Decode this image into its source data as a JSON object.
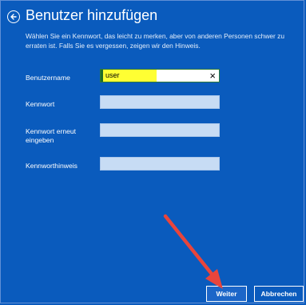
{
  "header": {
    "title": "Benutzer hinzufügen",
    "description": "Wählen Sie ein Kennwort, das leicht zu merken, aber von anderen Personen schwer zu erraten ist. Falls Sie es vergessen, zeigen wir den Hinweis."
  },
  "form": {
    "username_label": "Benutzername",
    "username_value": "user",
    "clear_icon": "×",
    "password_label": "Kennwort",
    "password_value": "",
    "password_repeat_label": "Kennwort erneut eingeben",
    "password_repeat_value": "",
    "hint_label": "Kennworthinweis",
    "hint_value": ""
  },
  "buttons": {
    "next": "Weiter",
    "cancel": "Abbrechen"
  },
  "colors": {
    "background": "#0a5bbd",
    "annotation_arrow": "#e8453c",
    "highlight": "#ffff33"
  }
}
